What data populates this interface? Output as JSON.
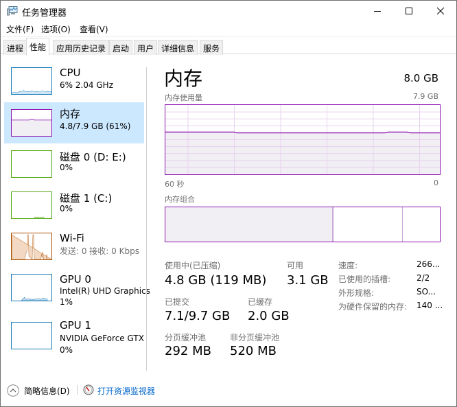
{
  "window": {
    "title": "任务管理器",
    "controls": {
      "minimize": "minimize",
      "maximize": "maximize",
      "close": "close"
    }
  },
  "menu": [
    "文件(F)",
    "选项(O)",
    "查看(V)"
  ],
  "tabs": [
    {
      "label": "进程",
      "active": false
    },
    {
      "label": "性能",
      "active": true
    },
    {
      "label": "应用历史记录",
      "active": false
    },
    {
      "label": "启动",
      "active": false
    },
    {
      "label": "用户",
      "active": false
    },
    {
      "label": "详细信息",
      "active": false
    },
    {
      "label": "服务",
      "active": false
    }
  ],
  "sidebar": {
    "items": [
      {
        "key": "cpu",
        "title": "CPU",
        "lines": [
          "6% 2.04 GHz"
        ],
        "color": "#1979b8",
        "selected": false
      },
      {
        "key": "memory",
        "title": "内存",
        "lines": [
          "4.8/7.9 GB (61%)"
        ],
        "color": "#8b12ae",
        "selected": true,
        "usage_fraction": 0.61
      },
      {
        "key": "disk0",
        "title": "磁盘 0 (D: E:)",
        "lines": [
          "0%"
        ],
        "color": "#4da60c",
        "selected": false
      },
      {
        "key": "disk1",
        "title": "磁盘 1 (C:)",
        "lines": [
          "0%"
        ],
        "color": "#4da60c",
        "selected": false
      },
      {
        "key": "wifi",
        "title": "Wi-Fi",
        "lines": [
          "发送: 0 接收: 0 Kbps"
        ],
        "color": "#a74f01",
        "selected": false
      },
      {
        "key": "gpu0",
        "title": "GPU 0",
        "lines": [
          "Intel(R) UHD Graphics",
          "1%"
        ],
        "color": "#1979b8",
        "selected": false
      },
      {
        "key": "gpu1",
        "title": "GPU 1",
        "lines": [
          "NVIDIA GeForce GTX",
          "0%"
        ],
        "color": "#1979b8",
        "selected": false
      }
    ]
  },
  "main": {
    "title": "内存",
    "total": "8.0 GB",
    "usage_graph": {
      "label": "内存使用量",
      "max_label": "7.9 GB",
      "x_left_label": "60 秒",
      "x_right_label": "0",
      "color": "#8b12ae",
      "usage_fraction": 0.61
    },
    "composition": {
      "label": "内存组合",
      "in_use_fraction": 0.61,
      "modified_fraction": 0.005,
      "standby_fraction": 0.25
    },
    "stats": {
      "in_use": {
        "label": "使用中(已压缩)",
        "value": "4.8 GB (119 MB)"
      },
      "available": {
        "label": "可用",
        "value": "3.1 GB"
      },
      "committed": {
        "label": "已提交",
        "value": "7.1/9.7 GB"
      },
      "cached": {
        "label": "已缓存",
        "value": "2.0 GB"
      },
      "paged_pool": {
        "label": "分页缓冲池",
        "value": "292 MB"
      },
      "nonpaged_pool": {
        "label": "非分页缓冲池",
        "value": "520 MB"
      }
    },
    "details": [
      {
        "key": "速度:",
        "value": "266..."
      },
      {
        "key": "已使用的插槽:",
        "value": "2/2"
      },
      {
        "key": "外形规格:",
        "value": "SO..."
      },
      {
        "key": "为硬件保留的内存:",
        "value": "140 ..."
      }
    ]
  },
  "footer": {
    "fewer_details": "简略信息(D)",
    "open_resource_monitor": "打开资源监视器"
  }
}
